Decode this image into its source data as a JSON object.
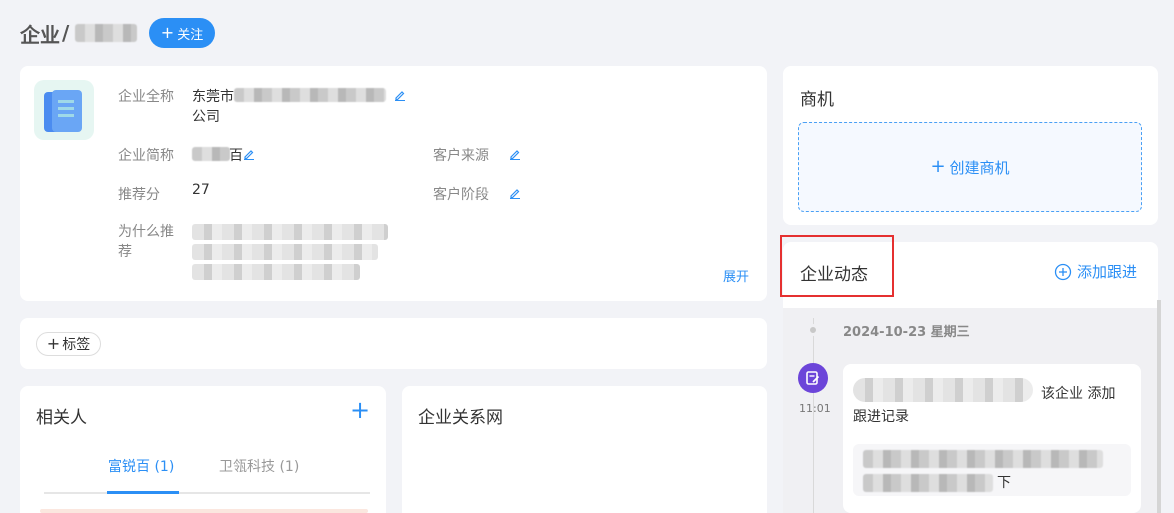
{
  "header": {
    "title": "企业",
    "separator": "/",
    "follow_label": "关注",
    "follow_icon": "plus-icon"
  },
  "company": {
    "full_name_label": "企业全称",
    "full_name_prefix": "东莞市",
    "full_name_suffix": "公司",
    "short_name_label": "企业简称",
    "short_name_suffix": "百",
    "source_label": "客户来源",
    "score_label": "推荐分",
    "score_value": "27",
    "stage_label": "客户阶段",
    "reason_label": "为什么推荐",
    "expand_label": "展开"
  },
  "tags": {
    "add_label": "标签"
  },
  "contacts": {
    "title": "相关人",
    "tabs": [
      {
        "label": "富锐百 (1)",
        "active": true
      },
      {
        "label": "卫瓴科技 (1)",
        "active": false
      }
    ]
  },
  "network": {
    "title": "企业关系网"
  },
  "opportunity": {
    "title": "商机",
    "create_label": "创建商机"
  },
  "activity": {
    "title": "企业动态",
    "add_follow_label": "添加跟进",
    "date": "2024-10-23 星期三",
    "entries": [
      {
        "time": "11:01",
        "text_tail": "该企业 添加",
        "text_line2": "跟进记录",
        "detail_tail": "下"
      }
    ]
  },
  "colors": {
    "accent": "#2b8ff5",
    "highlight": "#e53030",
    "activity_icon": "#6c45d9"
  }
}
